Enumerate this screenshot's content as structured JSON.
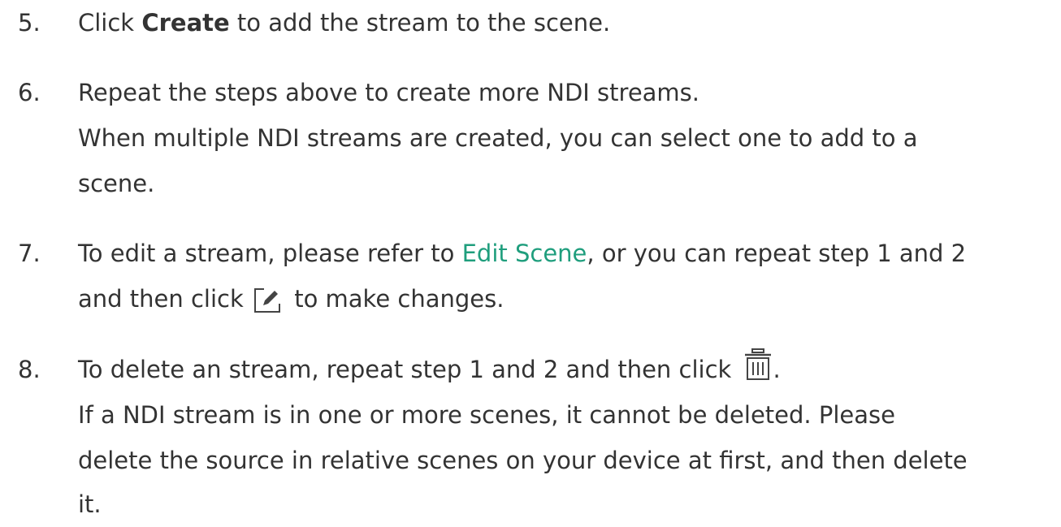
{
  "steps": [
    {
      "number": "5.",
      "text_before": "Click ",
      "bold": "Create",
      "text_after": " to add the stream to the scene."
    },
    {
      "number": "6.",
      "line1": "Repeat the steps above to create more NDI streams.",
      "line2": "When multiple NDI streams are created, you can select one to add to a",
      "line3": "scene."
    },
    {
      "number": "7.",
      "text_before": "To edit a stream, please refer to ",
      "link": "Edit Scene",
      "text_after": ", or you can repeat step 1 and 2",
      "line2_before": "and then click ",
      "icon": "edit-icon",
      "line2_after": " to make changes."
    },
    {
      "number": "8.",
      "text_before": "To delete an stream, repeat step 1 and 2 and then click ",
      "icon": "trash-icon",
      "text_after": ".",
      "line2": "If a NDI stream is in one or more scenes, it cannot be deleted. Please",
      "line3": "delete the source in relative scenes on your device at first, and then delete",
      "line4": "it."
    }
  ],
  "colors": {
    "text": "#333333",
    "link": "#1f9e7d",
    "icon": "#444444"
  }
}
